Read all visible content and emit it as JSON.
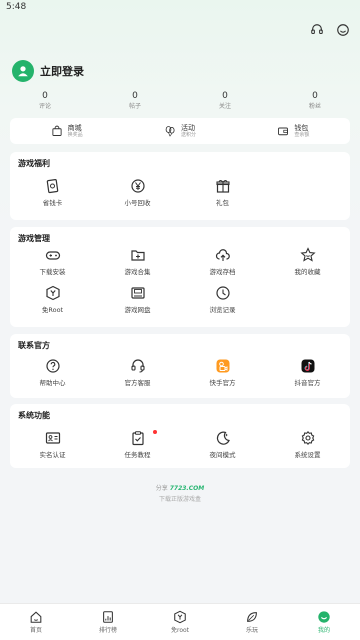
{
  "status": {
    "time": "5:48"
  },
  "header": {
    "icons": [
      "headset-icon",
      "smile-face-icon"
    ]
  },
  "profile": {
    "login_label": "立即登录",
    "avatar_icon": "user-icon"
  },
  "stats": [
    {
      "value": "0",
      "label": "评论"
    },
    {
      "value": "0",
      "label": "帖子"
    },
    {
      "value": "0",
      "label": "关注"
    },
    {
      "value": "0",
      "label": "粉丝"
    }
  ],
  "shortcuts": [
    {
      "title": "商城",
      "sub": "换奖品",
      "icon": "shopping-bag-icon"
    },
    {
      "title": "活动",
      "sub": "送积分",
      "icon": "balloon-icon"
    },
    {
      "title": "钱包",
      "sub": "查余额",
      "icon": "wallet-icon"
    }
  ],
  "sections": {
    "welfare": {
      "title": "游戏福利",
      "items": [
        {
          "label": "省钱卡",
          "icon": "card-icon"
        },
        {
          "label": "小号回收",
          "icon": "yen-recycle-icon"
        },
        {
          "label": "礼包",
          "icon": "gift-icon"
        }
      ]
    },
    "manage": {
      "title": "游戏管理",
      "items": [
        {
          "label": "下载安装",
          "icon": "gamepad-icon"
        },
        {
          "label": "游戏合集",
          "icon": "folder-plus-icon"
        },
        {
          "label": "游戏存档",
          "icon": "cloud-upload-icon"
        },
        {
          "label": "我的收藏",
          "icon": "star-face-icon"
        },
        {
          "label": "免Root",
          "icon": "shield-y-icon"
        },
        {
          "label": "游戏网盘",
          "icon": "disk-icon"
        },
        {
          "label": "浏览记录",
          "icon": "clock-icon"
        }
      ]
    },
    "official": {
      "title": "联系官方",
      "items": [
        {
          "label": "帮助中心",
          "icon": "help-icon"
        },
        {
          "label": "官方客服",
          "icon": "headset-icon"
        },
        {
          "label": "快手官方",
          "icon": "kuaishou-icon"
        },
        {
          "label": "抖音官方",
          "icon": "douyin-icon"
        }
      ]
    },
    "system": {
      "title": "系统功能",
      "items": [
        {
          "label": "实名认证",
          "icon": "id-card-icon"
        },
        {
          "label": "任务教程",
          "icon": "clipboard-check-icon"
        },
        {
          "label": "夜间模式",
          "icon": "moon-icon"
        },
        {
          "label": "系统设置",
          "icon": "gear-icon"
        }
      ]
    }
  },
  "footer": {
    "share_prefix": "分享",
    "brand": "7723.COM",
    "tagline": "下载正版游戏盒"
  },
  "tabs": [
    {
      "label": "首页",
      "icon": "home-icon"
    },
    {
      "label": "排行榜",
      "icon": "ranking-icon"
    },
    {
      "label": "免root",
      "icon": "shield-y-icon"
    },
    {
      "label": "乐玩",
      "icon": "leaf-icon"
    },
    {
      "label": "我的",
      "icon": "smile-icon"
    }
  ],
  "colors": {
    "accent": "#24b36b",
    "card": "#ffffff",
    "background": "#f3f5f7"
  }
}
